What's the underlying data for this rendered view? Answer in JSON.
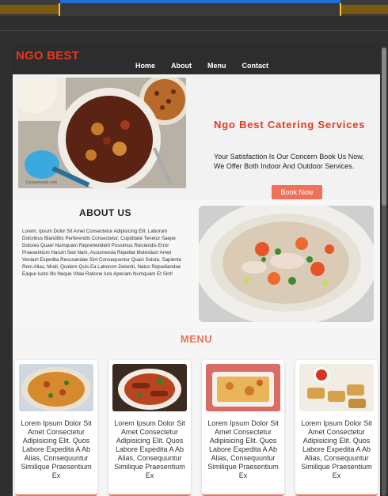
{
  "site": {
    "logo": "NGO BEST",
    "nav": [
      "Home",
      "About",
      "Menu",
      "Contact"
    ]
  },
  "hero": {
    "title": "Ngo Best Catering Services",
    "text": "Your Satisfaction Is Our Concern Book Us Now, We Offer Both Indoor And Outdoor Services.",
    "button": "Book Now",
    "image_caption": "Cozyamerak.com"
  },
  "about": {
    "title": "ABOUT US",
    "text": "Lorem, Ipsum Dolor Sit Amet Consectetur Adipisicing Elit. Laborum Doloribus Blanditiis Perferendis Consectetur, Cupiditate Tenetur Saepe Dolores Quae! Numquam Reprehenderit Possimus Reiciendis Error Praesentium Harum Sed Nam, Assumenda Repellat Molestias! Amet Veniam Expedita Recusandae Sint Consequuntur Quasi Soluta. Sapiente Rem Alias, Modi, Quidem Quis Ea Laborum Deleniti, Natus Repudiandae Eaque Iusto Illo Neque Vitae Ratione Iure Aperiam Numquam Et Sint!"
  },
  "menu": {
    "title": "MENU",
    "cards": [
      {
        "text": "Lorem Ipsum Dolor Sit Amet Consectetur Adipisicing Elit. Quos Labore Expedita A Ab Alias, Consequuntur Similique Praesentium Ex"
      },
      {
        "text": "Lorem Ipsum Dolor Sit Amet Consectetur Adipisicing Elit. Quos Labore Expedita A Ab Alias, Consequuntur Similique Praesentium Ex"
      },
      {
        "text": "Lorem Ipsum Dolor Sit Amet Consectetur Adipisicing Elit. Quos Labore Expedita A Ab Alias, Consequuntur Similique Praesentium Ex"
      },
      {
        "text": "Lorem Ipsum Dolor Sit Amet Consectetur Adipisicing Elit. Quos Labore Expedita A Ab Alias, Consequuntur Similique Praesentium Ex"
      }
    ]
  },
  "colors": {
    "accent": "#e8381b",
    "button": "#f07157",
    "header_bg": "#2d2d2d"
  }
}
